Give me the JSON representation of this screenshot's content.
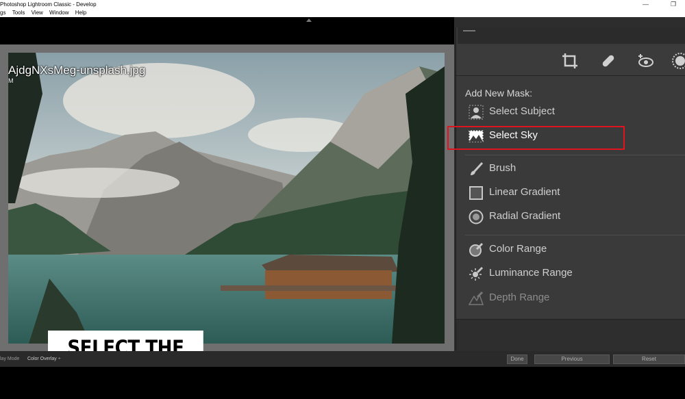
{
  "window": {
    "title": "Photoshop Lightroom Classic - Develop",
    "minimize_glyph": "—",
    "restore_glyph": "❐"
  },
  "menu": [
    "gs",
    "Tools",
    "View",
    "Window",
    "Help"
  ],
  "photo": {
    "filename": "AjdgNXsMeg-unsplash.jpg",
    "info": "M",
    "caption": "SELECT THE SKY"
  },
  "toolbar": {
    "icons": [
      "crop-icon",
      "healing-icon",
      "red-eye-icon",
      "masking-icon"
    ]
  },
  "masks": {
    "heading": "Add New Mask:",
    "items": [
      {
        "label": "Select Subject",
        "icon": "select-subject-icon"
      },
      {
        "label": "Select Sky",
        "icon": "select-sky-icon",
        "highlighted": true
      },
      {
        "label": "Brush",
        "icon": "brush-icon"
      },
      {
        "label": "Linear Gradient",
        "icon": "linear-gradient-icon"
      },
      {
        "label": "Radial Gradient",
        "icon": "radial-gradient-icon"
      },
      {
        "label": "Color Range",
        "icon": "color-range-icon"
      },
      {
        "label": "Luminance Range",
        "icon": "luminance-range-icon"
      },
      {
        "label": "Depth Range",
        "icon": "depth-range-icon",
        "disabled": true
      }
    ],
    "highlight_color": "#e0141e"
  },
  "bottom": {
    "overlay_label": "lay Mode",
    "overlay_value": "Color Overlay  ÷",
    "done": "Done",
    "previous": "Previous",
    "reset": "Reset"
  }
}
